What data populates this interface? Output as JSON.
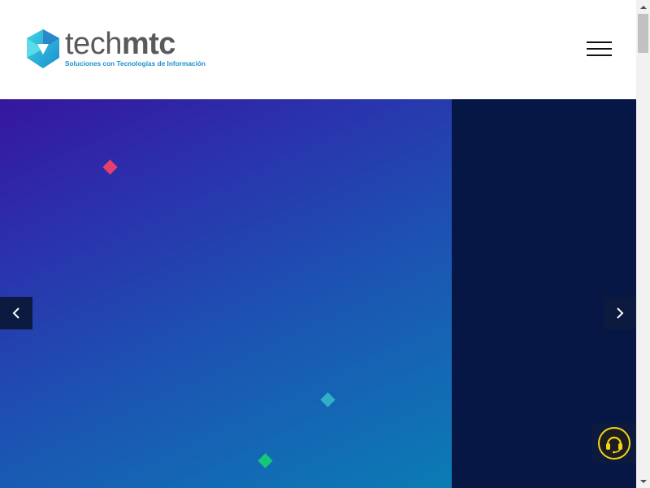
{
  "header": {
    "logo": {
      "word_light": "tech",
      "word_bold": "mtc",
      "tagline": "Soluciones con Tecnologías de Información",
      "colors": {
        "teal": "#2ec4d6",
        "blue": "#1a8fd0",
        "dark": "#5a5a5a"
      }
    },
    "menu_icon": "hamburger-icon"
  },
  "hero": {
    "gradient": [
      "#36169f",
      "#0b7cb4"
    ],
    "right_panel_color": "#061645",
    "diamond_colors": {
      "pink": "#e4406b",
      "teal": "#2fb0c7",
      "green": "#14c878"
    },
    "prev_icon": "chevron-left-icon",
    "next_icon": "chevron-right-icon"
  },
  "support_widget": {
    "icon": "headset-icon",
    "accent": "#f2d51b"
  }
}
